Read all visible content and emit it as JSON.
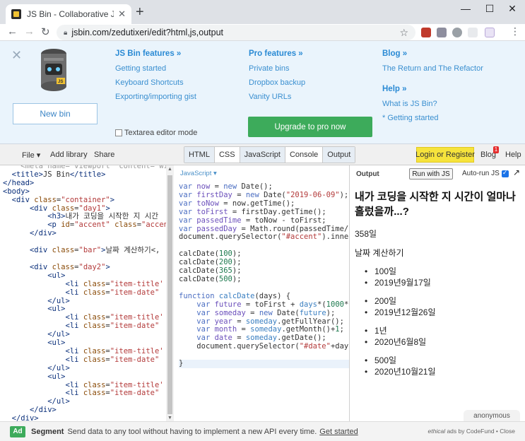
{
  "browser": {
    "tab_title": "JS Bin - Collaborative JavaScript",
    "url": "jsbin.com/zedutixeri/edit?html,js,output"
  },
  "help_panel": {
    "new_bin_label": "New bin",
    "columns": [
      {
        "heading": "JS Bin features »",
        "links": [
          "Getting started",
          "Keyboard Shortcuts",
          "Exporting/importing gist"
        ]
      },
      {
        "heading": "Pro features »",
        "links": [
          "Private bins",
          "Dropbox backup",
          "Vanity URLs"
        ]
      },
      {
        "heading": "Blog »",
        "links": [
          "The Return and The Refactor"
        ]
      },
      {
        "heading": "Help »",
        "links": [
          "What is JS Bin?",
          "* Getting started"
        ]
      }
    ],
    "textarea_option": "Textarea editor mode",
    "upgrade_label": "Upgrade to pro now"
  },
  "toolbar": {
    "menu": [
      "File ▾",
      "Add library",
      "Share"
    ],
    "panels": [
      "HTML",
      "CSS",
      "JavaScript",
      "Console",
      "Output"
    ],
    "login_label": "Login or Register",
    "blog_label": "Blog",
    "blog_badge": "1",
    "help_label": "Help"
  },
  "js_pane": {
    "label": "JavaScript ▾"
  },
  "output": {
    "label": "Output",
    "run_label": "Run with JS",
    "autorun_label": "Auto-run JS",
    "heading": "내가 코딩을 시작한 지 시간이 얼마나 흘렀을까...?",
    "accent": "358일",
    "bar": "날짜 계산하기",
    "groups": [
      {
        "title": "100일",
        "date": "2019년9월17일"
      },
      {
        "title": "200일",
        "date": "2019년12월26일"
      },
      {
        "title": "1년",
        "date": "2020년6월8일"
      },
      {
        "title": "500일",
        "date": "2020년10월21일"
      }
    ],
    "anonymous_label": "anonymous"
  },
  "ad": {
    "badge": "Ad",
    "brand": "Segment",
    "text": "Send data to any tool without having to implement a new API every time.",
    "link": "Get started",
    "credit_italic": "ethical",
    "credit_rest": " ads by CodeFund • Close"
  },
  "colors": {
    "accent_green": "#3dab5b",
    "link_blue": "#2a8ad4",
    "login_yellow": "#f6e33c",
    "panel_bg": "#eaf4fc"
  }
}
